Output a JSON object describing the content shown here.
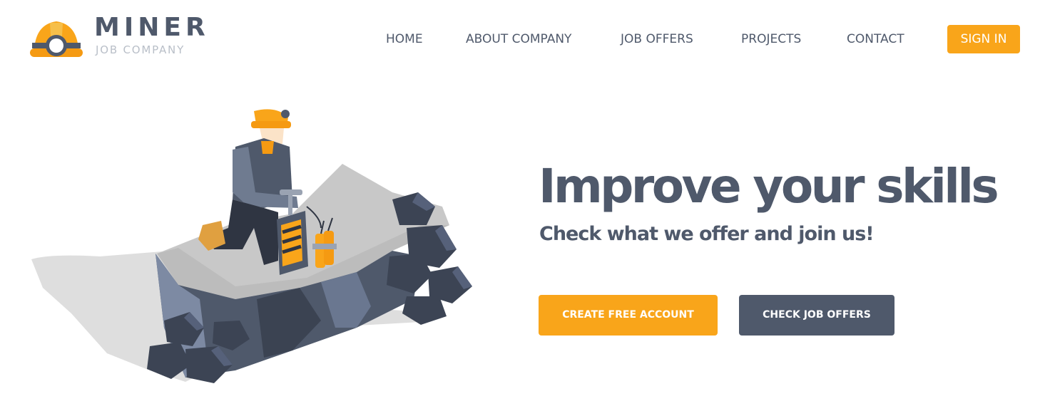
{
  "brand": {
    "name": "MINER",
    "tagline": "JOB COMPANY",
    "accent_color": "#f9a51a",
    "dark_color": "#4f596b",
    "logo_icon": "miner-helmet-icon"
  },
  "nav": {
    "items": [
      {
        "label": "HOME"
      },
      {
        "label": "ABOUT COMPANY"
      },
      {
        "label": "JOB OFFERS"
      },
      {
        "label": "PROJECTS"
      },
      {
        "label": "CONTACT"
      }
    ],
    "sign_in_label": "SIGN IN"
  },
  "hero": {
    "title": "Improve your skills",
    "subtitle": "Check what we offer and join us!",
    "primary_button": "CREATE FREE ACCOUNT",
    "secondary_button": "CHECK JOB OFFERS",
    "illustration": "miner-with-detonator-illustration"
  }
}
